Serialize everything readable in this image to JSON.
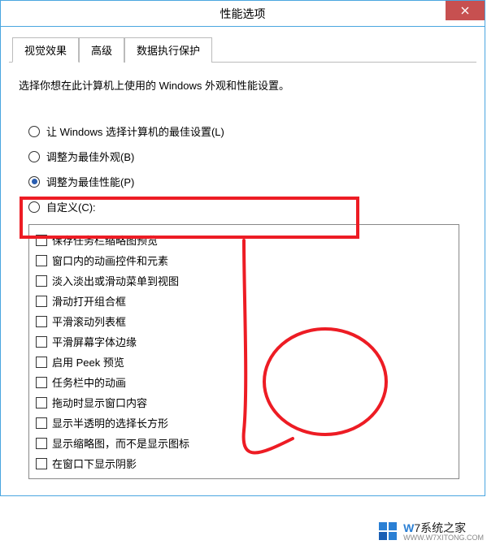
{
  "window": {
    "title": "性能选项"
  },
  "tabs": {
    "visual": "视觉效果",
    "advanced": "高级",
    "dep": "数据执行保护"
  },
  "panel": {
    "desc": "选择你想在此计算机上使用的 Windows 外观和性能设置。"
  },
  "radios": {
    "auto": "让 Windows 选择计算机的最佳设置(L)",
    "best_look": "调整为最佳外观(B)",
    "best_perf": "调整为最佳性能(P)",
    "custom": "自定义(C):"
  },
  "checkboxes": [
    "保存任务栏缩略图预览",
    "窗口内的动画控件和元素",
    "淡入淡出或滑动菜单到视图",
    "滑动打开组合框",
    "平滑滚动列表框",
    "平滑屏幕字体边缘",
    "启用 Peek 预览",
    "任务栏中的动画",
    "拖动时显示窗口内容",
    "显示半透明的选择长方形",
    "显示缩略图，而不是显示图标",
    "在窗口下显示阴影"
  ],
  "watermark": {
    "brand": "7系统之家",
    "url": "WWW.W7XITONG.COM"
  }
}
